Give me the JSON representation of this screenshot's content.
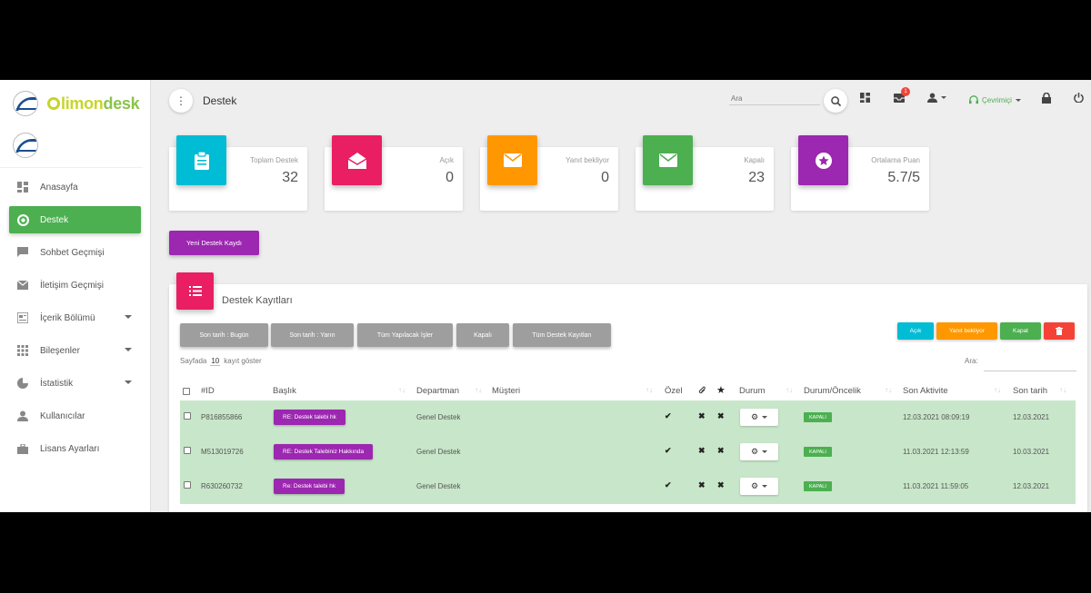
{
  "app": {
    "brand_prefix": "limon",
    "brand_suffix": "desk"
  },
  "sidebar": {
    "items": [
      {
        "label": "Anasayfa",
        "icon": "dashboard-icon",
        "active": false,
        "expandable": false
      },
      {
        "label": "Destek",
        "icon": "support-icon",
        "active": true,
        "expandable": false
      },
      {
        "label": "Sohbet Geçmişi",
        "icon": "chat-icon",
        "active": false,
        "expandable": false
      },
      {
        "label": "İletişim Geçmişi",
        "icon": "mail-icon",
        "active": false,
        "expandable": false
      },
      {
        "label": "İçerik Bölümü",
        "icon": "content-icon",
        "active": false,
        "expandable": true
      },
      {
        "label": "Bileşenler",
        "icon": "grid-icon",
        "active": false,
        "expandable": true
      },
      {
        "label": "İstatistik",
        "icon": "pie-chart-icon",
        "active": false,
        "expandable": true
      },
      {
        "label": "Kullanıcılar",
        "icon": "user-icon",
        "active": false,
        "expandable": false
      },
      {
        "label": "Lisans Ayarları",
        "icon": "briefcase-icon",
        "active": false,
        "expandable": false
      }
    ]
  },
  "topbar": {
    "page_title": "Destek",
    "search_placeholder": "Ara",
    "notification_count": "1",
    "status": "Çevrimiçi"
  },
  "stats": [
    {
      "label": "Toplam Destek",
      "value": "32",
      "color": "#00bcd4",
      "icon": "clipboard-icon"
    },
    {
      "label": "Açık",
      "value": "0",
      "color": "#e91e63",
      "icon": "open-mail-icon"
    },
    {
      "label": "Yanıt bekliyor",
      "value": "0",
      "color": "#ff9800",
      "icon": "mail-icon"
    },
    {
      "label": "Kapalı",
      "value": "23",
      "color": "#4caf50",
      "icon": "mail-icon"
    },
    {
      "label": "Ortalama Puan",
      "value": "5.7/5",
      "color": "#9c27b0",
      "icon": "star-icon"
    }
  ],
  "new_ticket_label": "Yeni Destek Kaydı",
  "panel": {
    "title": "Destek Kayıtları",
    "filters": [
      "Son tarih : Bugün",
      "Son tarih : Yarın",
      "Tüm Yapılacak İşler",
      "Kapalı",
      "Tüm Destek Kayıtları"
    ],
    "actions": [
      {
        "label": "Açık",
        "color": "#00bcd4"
      },
      {
        "label": "Yanıt bekliyor",
        "color": "#ff9800"
      },
      {
        "label": "Kapat",
        "color": "#4caf50"
      },
      {
        "label": "",
        "color": "#f44336",
        "icon": "trash-icon"
      }
    ],
    "per_page_prefix": "Sayfada",
    "per_page_value": "10",
    "per_page_suffix": "kayıt göster",
    "search_label": "Ara:"
  },
  "table": {
    "columns": [
      "#ID",
      "Başlık",
      "Departman",
      "Müşteri",
      "Özel",
      "Durum",
      "Durum/Öncelik",
      "Son Aktivite",
      "Son tarih"
    ],
    "rows": [
      {
        "id": "P816855866",
        "title": "RE: Destek talebi hk",
        "department": "Genel Destek",
        "customer": "",
        "status": "KAPALI",
        "last_activity": "12.03.2021 08:09:19",
        "due": "12.03.2021"
      },
      {
        "id": "M513019726",
        "title": "RE: Destek Talebiniz Hakkında",
        "department": "Genel Destek",
        "customer": "",
        "status": "KAPALI",
        "last_activity": "11.03.2021 12:13:59",
        "due": "10.03.2021"
      },
      {
        "id": "R630260732",
        "title": "Re: Destek talebi hk",
        "department": "Genel Destek",
        "customer": "",
        "status": "KAPALI",
        "last_activity": "11.03.2021 11:59:05",
        "due": "12.03.2021"
      }
    ]
  }
}
